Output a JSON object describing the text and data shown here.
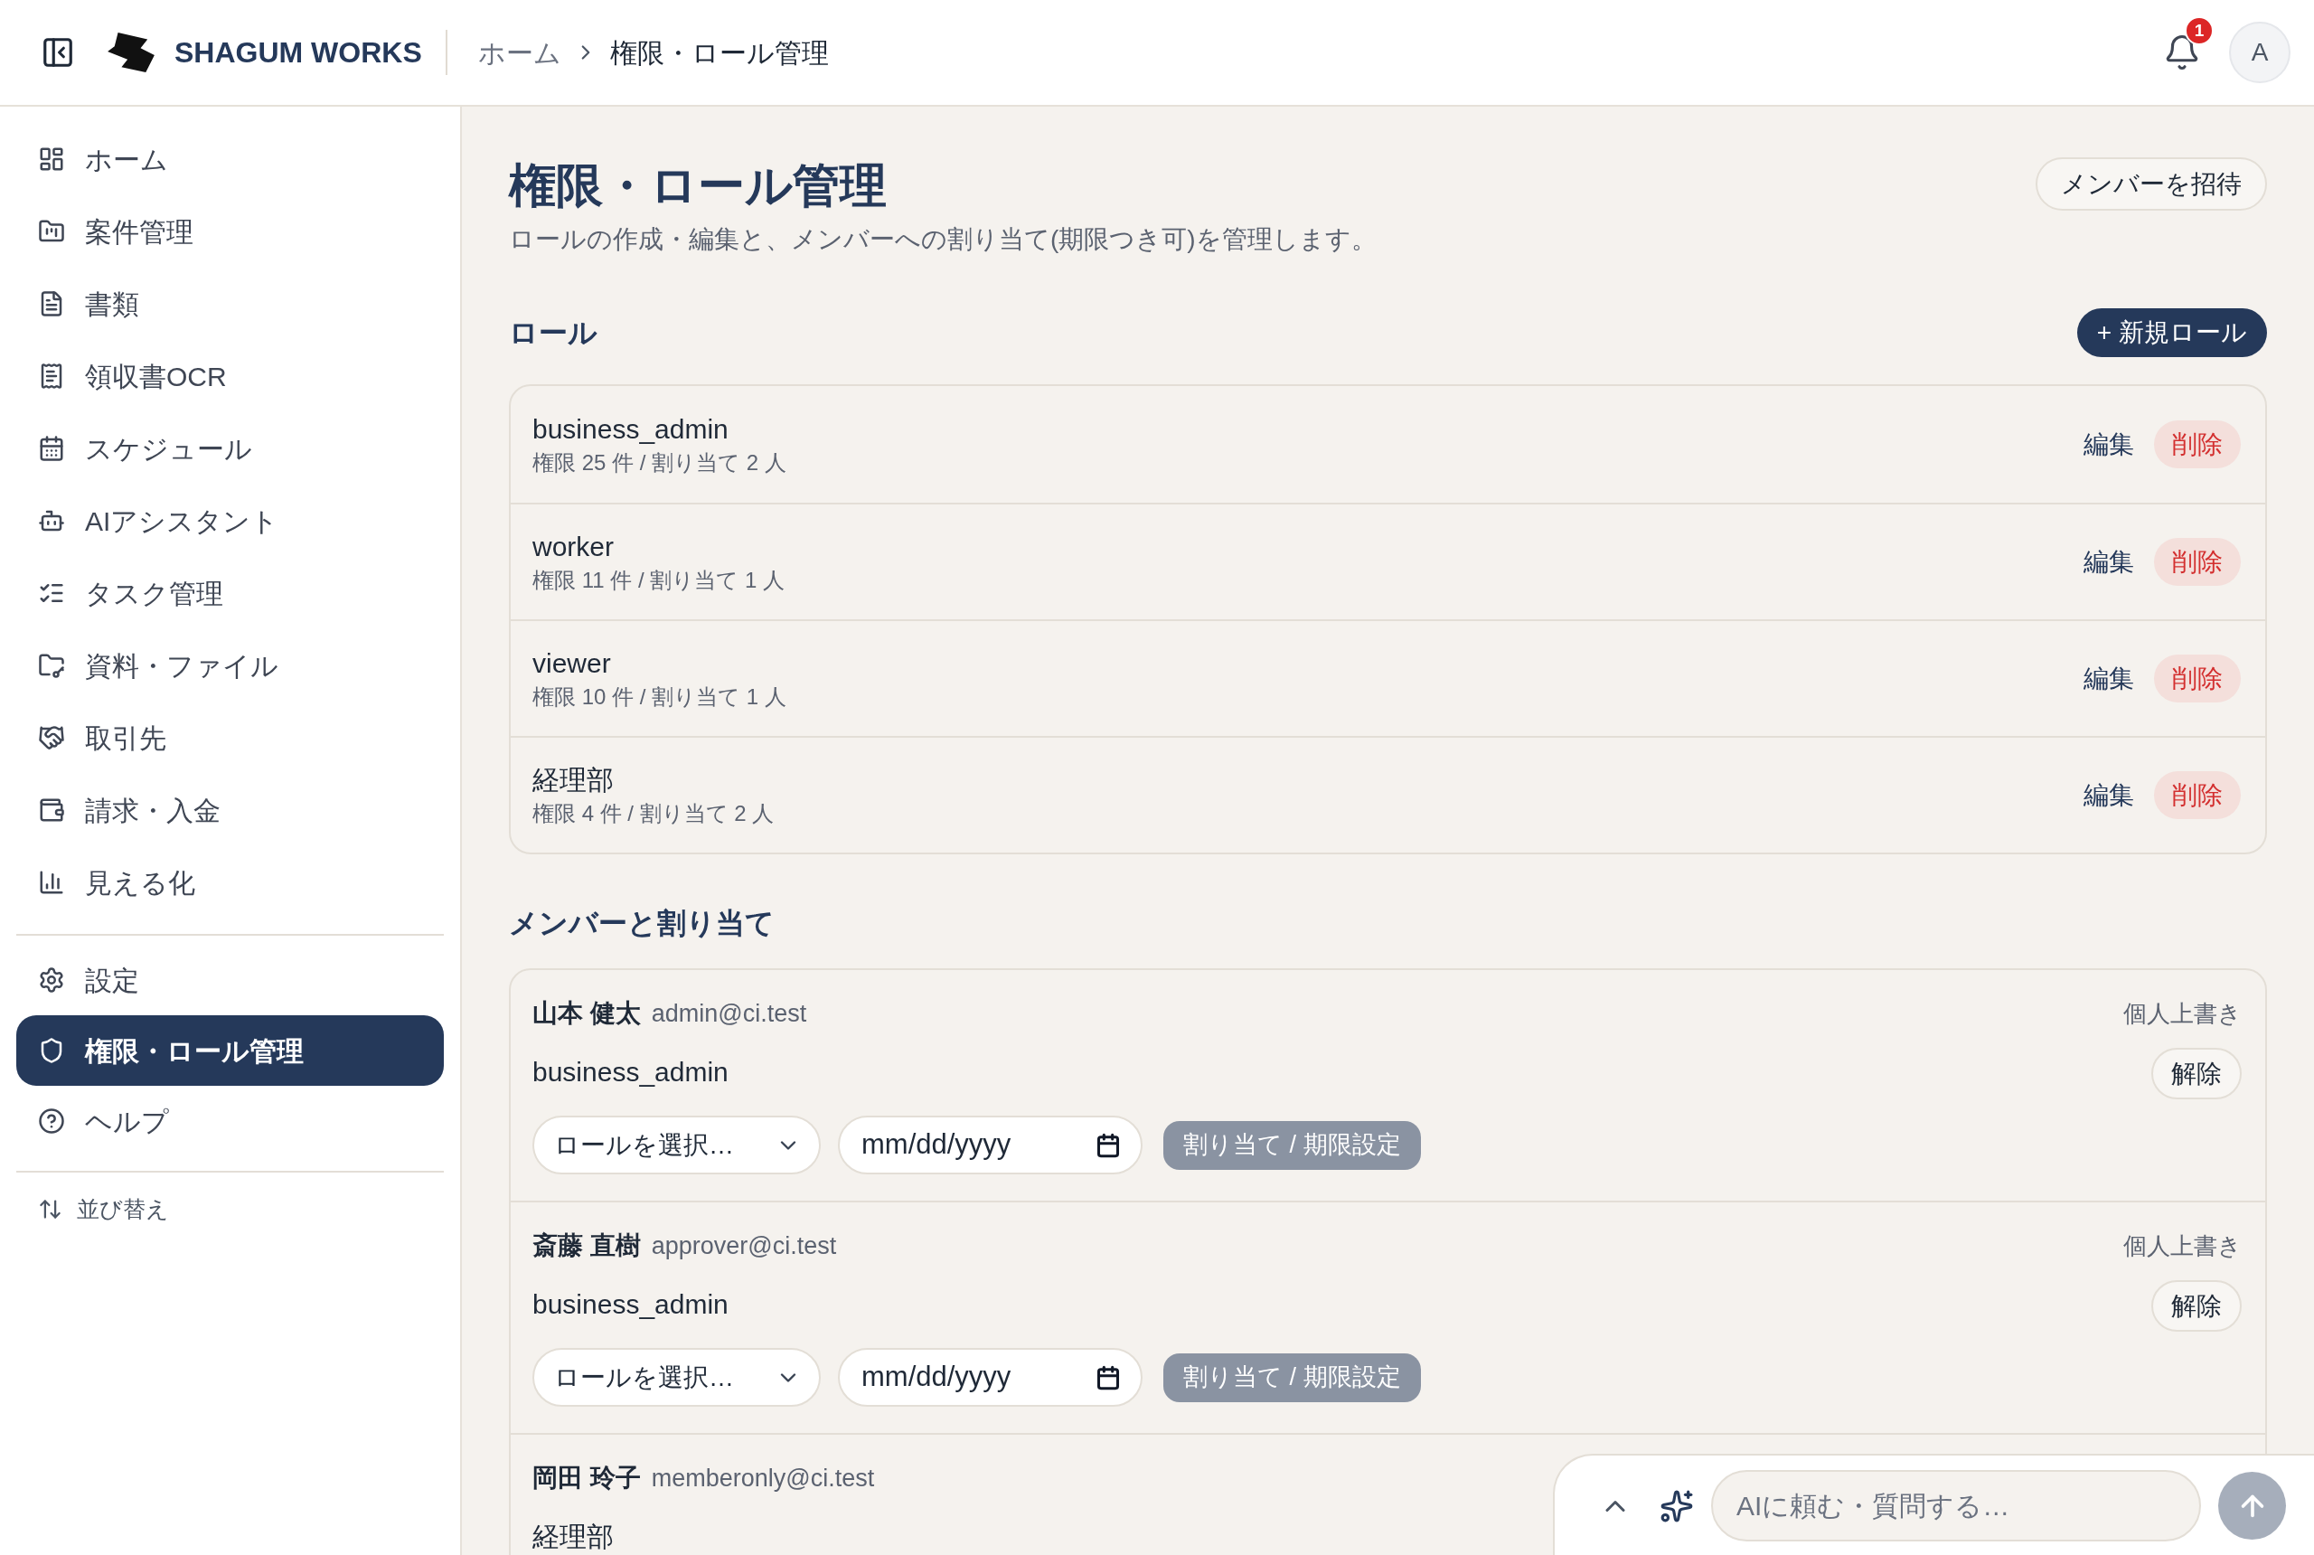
{
  "header": {
    "brand": "SHAGUM WORKS",
    "breadcrumb": [
      {
        "label": "ホーム",
        "current": false
      },
      {
        "label": "権限・ロール管理",
        "current": true
      }
    ],
    "notifications": {
      "count": "1"
    },
    "avatar": {
      "initial": "A"
    }
  },
  "sidebar": {
    "groups": [
      {
        "items": [
          {
            "label": "ホーム",
            "selected": false
          },
          {
            "label": "案件管理",
            "selected": false
          },
          {
            "label": "書類",
            "selected": false
          },
          {
            "label": "領収書OCR",
            "selected": false
          },
          {
            "label": "スケジュール",
            "selected": false
          },
          {
            "label": "AIアシスタント",
            "selected": false
          },
          {
            "label": "タスク管理",
            "selected": false
          },
          {
            "label": "資料・ファイル",
            "selected": false
          },
          {
            "label": "取引先",
            "selected": false
          },
          {
            "label": "請求・入金",
            "selected": false
          },
          {
            "label": "見える化",
            "selected": false
          }
        ]
      },
      {
        "items": [
          {
            "label": "設定",
            "selected": false
          },
          {
            "label": "権限・ロール管理",
            "selected": true
          },
          {
            "label": "ヘルプ",
            "selected": false
          }
        ]
      }
    ],
    "sort_button": {
      "label": "並び替え"
    }
  },
  "page": {
    "title": "権限・ロール管理",
    "subtitle": "ロールの作成・編集と、メンバーへの割り当て(期限つき可)を管理します。",
    "invite_button": "メンバーを招待"
  },
  "roles": {
    "heading": "ロール",
    "new_button": "+ 新規ロール",
    "items": [
      {
        "name": "business_admin",
        "summary": "権限 25 件 / 割り当て 2 人",
        "edit_button": "編集",
        "delete_button": "削除"
      },
      {
        "name": "worker",
        "summary": "権限 11 件 / 割り当て 1 人",
        "edit_button": "編集",
        "delete_button": "削除"
      },
      {
        "name": "viewer",
        "summary": "権限 10 件 / 割り当て 1 人",
        "edit_button": "編集",
        "delete_button": "削除"
      },
      {
        "name": "経理部",
        "summary": "権限 4 件 / 割り当て 2 人",
        "edit_button": "編集",
        "delete_button": "削除"
      }
    ]
  },
  "members": {
    "heading": "メンバーと割り当て",
    "items": [
      {
        "name": "山本 健太",
        "email": "admin@ci.test",
        "role": "business_admin",
        "override_label": "個人上書き",
        "release_button": "解除",
        "role_select": {
          "value": "ロールを選択…"
        },
        "date_field": {
          "placeholder": "mm/dd/yyyy"
        },
        "assign_button": {
          "label": "割り当て / 期限設定",
          "disabled": true
        }
      },
      {
        "name": "斎藤 直樹",
        "email": "approver@ci.test",
        "role": "business_admin",
        "override_label": "個人上書き",
        "release_button": "解除",
        "role_select": {
          "value": "ロールを選択…"
        },
        "date_field": {
          "placeholder": "mm/dd/yyyy"
        },
        "assign_button": {
          "label": "割り当て / 期限設定",
          "disabled": true
        }
      },
      {
        "name": "岡田 玲子",
        "email": "memberonly@ci.test",
        "role": "経理部"
      }
    ]
  },
  "chat": {
    "placeholder": "AIに頼む・質問する…",
    "send_button": {
      "disabled": true
    }
  }
}
